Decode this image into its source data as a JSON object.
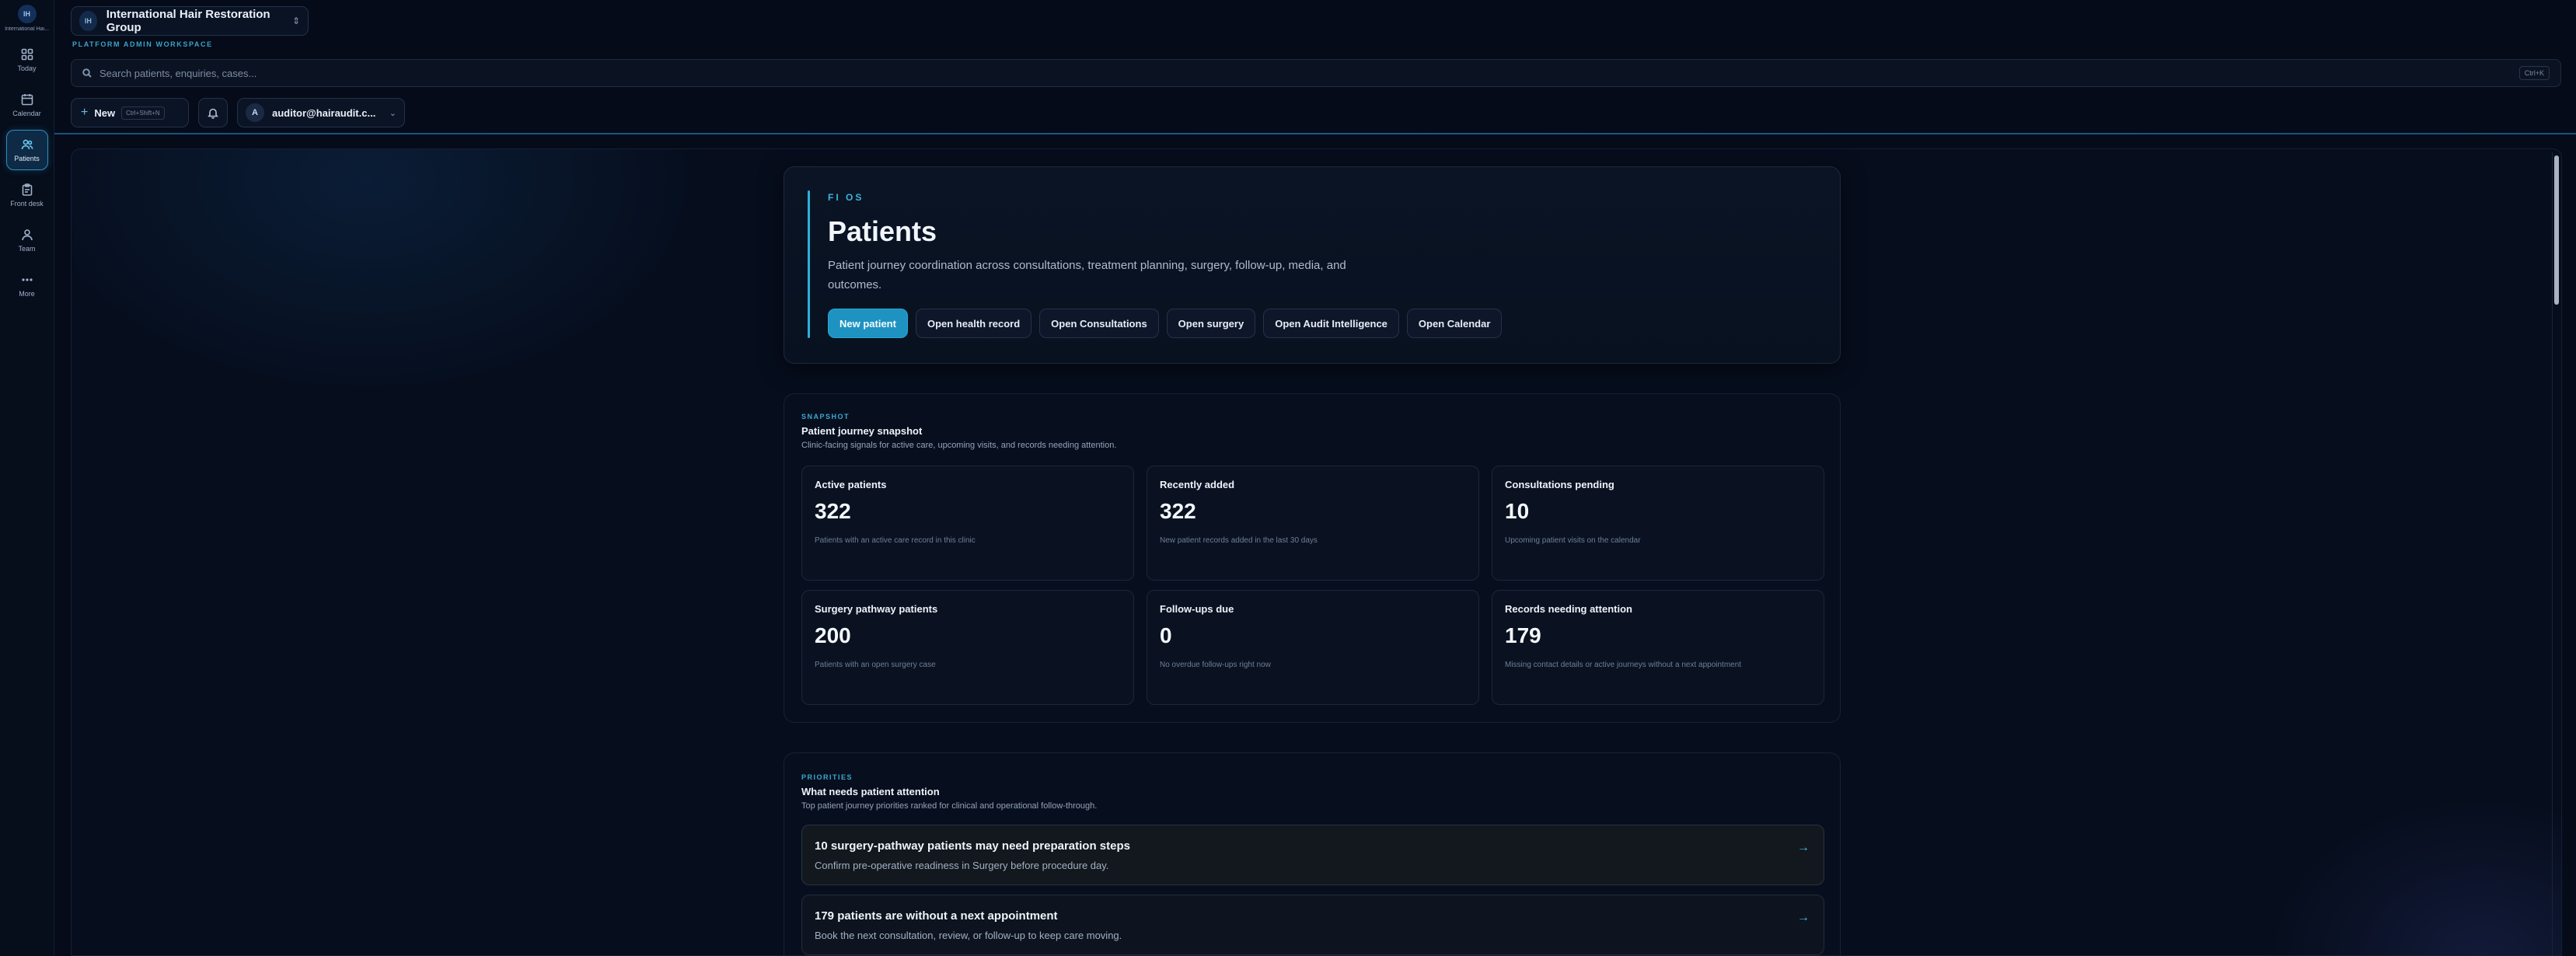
{
  "rail": {
    "org_initials": "IH",
    "org_short": "International Hai...",
    "items": [
      {
        "label": "Today",
        "icon": "grid-icon"
      },
      {
        "label": "Calendar",
        "icon": "calendar-icon"
      },
      {
        "label": "Patients",
        "icon": "users-icon",
        "active": true
      },
      {
        "label": "Front desk",
        "icon": "clipboard-icon"
      },
      {
        "label": "Team",
        "icon": "team-icon"
      },
      {
        "label": "More",
        "icon": "more-icon"
      }
    ]
  },
  "header": {
    "org_initials": "IH",
    "org_name": "International Hair Restoration Group",
    "workspace_label": "PLATFORM ADMIN WORKSPACE",
    "search_placeholder": "Search patients, enquiries, cases...",
    "search_shortcut": "Ctrl+K",
    "new_label": "New",
    "new_shortcut": "Ctrl+Shift+N",
    "user_initial": "A",
    "user_email": "auditor@hairaudit.c..."
  },
  "hero": {
    "eyebrow": "FI OS",
    "title": "Patients",
    "description": "Patient journey coordination across consultations, treatment planning, surgery, follow-up, media, and outcomes.",
    "actions": [
      {
        "label": "New patient",
        "primary": true
      },
      {
        "label": "Open health record"
      },
      {
        "label": "Open Consultations"
      },
      {
        "label": "Open surgery"
      },
      {
        "label": "Open Audit Intelligence"
      },
      {
        "label": "Open Calendar"
      }
    ]
  },
  "snapshot": {
    "eyebrow": "SNAPSHOT",
    "title": "Patient journey snapshot",
    "subtitle": "Clinic-facing signals for active care, upcoming visits, and records needing attention.",
    "cards": [
      {
        "label": "Active patients",
        "value": "322",
        "note": "Patients with an active care record in this clinic"
      },
      {
        "label": "Recently added",
        "value": "322",
        "note": "New patient records added in the last 30 days"
      },
      {
        "label": "Consultations pending",
        "value": "10",
        "note": "Upcoming patient visits on the calendar"
      },
      {
        "label": "Surgery pathway patients",
        "value": "200",
        "note": "Patients with an open surgery case"
      },
      {
        "label": "Follow-ups due",
        "value": "0",
        "note": "No overdue follow-ups right now"
      },
      {
        "label": "Records needing attention",
        "value": "179",
        "note": "Missing contact details or active journeys without a next appointment"
      }
    ]
  },
  "priorities": {
    "eyebrow": "PRIORITIES",
    "title": "What needs patient attention",
    "subtitle": "Top patient journey priorities ranked for clinical and operational follow-through.",
    "items": [
      {
        "title": "10 surgery-pathway patients may need preparation steps",
        "subtitle": "Confirm pre-operative readiness in Surgery before procedure day."
      },
      {
        "title": "179 patients are without a next appointment",
        "subtitle": "Book the next consultation, review, or follow-up to keep care moving."
      }
    ]
  },
  "colors": {
    "accent": "#1e93c1",
    "background": "#050b18"
  }
}
